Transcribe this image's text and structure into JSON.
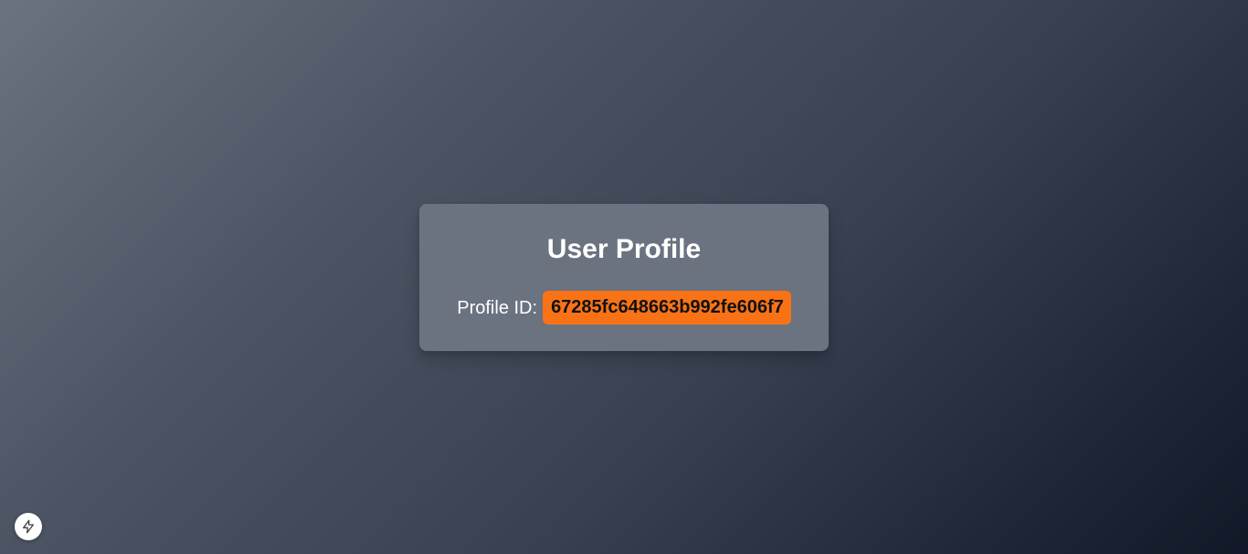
{
  "profile": {
    "title": "User Profile",
    "id_label": "Profile ID:",
    "id_value": "67285fc648663b992fe606f7"
  },
  "dev_indicator": {
    "icon": "lightning-bolt-icon"
  },
  "colors": {
    "card_background": "#6b7280",
    "badge_background": "#f97316",
    "gradient_start": "#6b7280",
    "gradient_end": "#111827"
  }
}
